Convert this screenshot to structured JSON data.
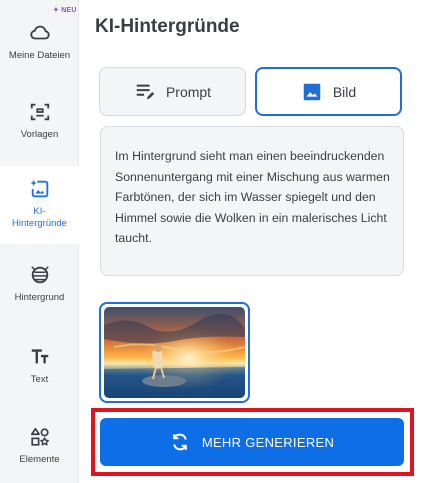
{
  "sidebar": {
    "badge": "NEU",
    "items": [
      {
        "label": "Meine Dateien",
        "icon": "cloud-icon"
      },
      {
        "label": "Vorlagen",
        "icon": "template-icon"
      },
      {
        "label": "KI-\nHintergründe",
        "icon": "ai-background-icon"
      },
      {
        "label": "Hintergrund",
        "icon": "background-icon"
      },
      {
        "label": "Text",
        "icon": "text-icon"
      },
      {
        "label": "Elemente",
        "icon": "elements-icon"
      }
    ]
  },
  "main": {
    "title": "KI-Hintergründe",
    "tabs": [
      {
        "label": "Prompt",
        "icon": "edit-lines-icon"
      },
      {
        "label": "Bild",
        "icon": "image-icon"
      }
    ],
    "prompt_text": "Im Hintergrund sieht man einen beeindruckenden Sonnenuntergang mit einer Mischung aus warmen Farbtönen, der sich im Wasser spiegelt und den Himmel sowie die Wolken in ein malerisches Licht taucht.",
    "generate_label": "MEHR GENERIEREN"
  },
  "colors": {
    "accent": "#0d6ee8",
    "active_border": "#1f6fd6",
    "highlight": "#e0141e",
    "badge": "#8a4fd6"
  }
}
